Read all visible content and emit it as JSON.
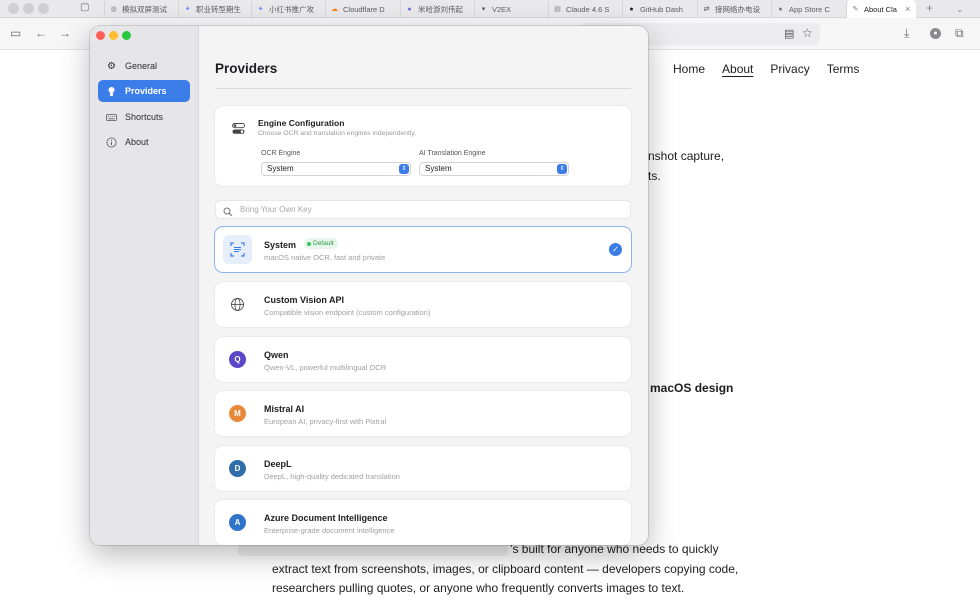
{
  "browser": {
    "tabs": [
      {
        "label": "模拟双屏测试",
        "icon": "globe-icon",
        "color": "#8a8a8f"
      },
      {
        "label": "职业转型期生",
        "icon": "sparkle-icon",
        "color": "#6b8cf5"
      },
      {
        "label": "小红书推广攻",
        "icon": "sparkle-icon",
        "color": "#6b8cf5"
      },
      {
        "label": "Cloudflare D",
        "icon": "cloud-icon",
        "color": "#f38020"
      },
      {
        "label": "米哈游刘伟起",
        "icon": "circle-icon",
        "color": "#6a6ad8"
      },
      {
        "label": "V2EX",
        "icon": "v2ex-icon",
        "color": "#555555"
      },
      {
        "label": "Claude 4.6 S",
        "icon": "doc-icon",
        "color": "#888888"
      },
      {
        "label": "GitHub Dash",
        "icon": "github-icon",
        "color": "#222222"
      },
      {
        "label": "接网络办电设",
        "icon": "link-icon",
        "color": "#555555"
      },
      {
        "label": "App Store C",
        "icon": "apple-icon",
        "color": "#777777"
      },
      {
        "label": "About Cla",
        "icon": "edit-icon",
        "color": "#777777"
      }
    ]
  },
  "site": {
    "nav": [
      "Home",
      "About",
      "Privacy",
      "Terms"
    ],
    "active_nav": "About",
    "fragments": {
      "line1": "nshot capture,",
      "line2": "ts.",
      "line3": "macOS design",
      "para1": "’s built for anyone who needs to quickly",
      "para2": "extract text from screenshots, images, or clipboard content — developers copying code,",
      "para3": "researchers pulling quotes, or anyone who frequently converts images to text."
    }
  },
  "sidebar": {
    "items": [
      {
        "label": "General",
        "icon": "gear-icon",
        "active": false
      },
      {
        "label": "Providers",
        "icon": "lightbulb-icon",
        "active": true
      },
      {
        "label": "Shortcuts",
        "icon": "keyboard-icon",
        "active": false
      },
      {
        "label": "About",
        "icon": "info-icon",
        "active": false
      }
    ]
  },
  "main": {
    "title": "Providers",
    "engine": {
      "title": "Engine Configuration",
      "subtitle": "Choose OCR and translation engines independently.",
      "ocr_label": "OCR Engine",
      "ocr_value": "System",
      "translation_label": "AI Translation Engine",
      "translation_value": "System"
    },
    "search": {
      "placeholder": "Bring Your Own Key",
      "value": ""
    },
    "providers": [
      {
        "name": "System",
        "description": "macOS native OCR, fast and private",
        "badge": "Default",
        "selected": true,
        "logo": "ocr-scan-icon",
        "initial": "",
        "color": "#3a7de8"
      },
      {
        "name": "Custom Vision API",
        "description": "Compatible vision endpoint (custom configuration)",
        "badge": "",
        "selected": false,
        "logo": "globe-icon",
        "initial": "",
        "color": "#ffffff"
      },
      {
        "name": "Qwen",
        "description": "Qwen-VL, powerful multilingual OCR",
        "badge": "",
        "selected": false,
        "logo": "qwen-logo-icon",
        "initial": "Q",
        "color": "#5b48c9"
      },
      {
        "name": "Mistral AI",
        "description": "European AI, privacy-first with Pixtral",
        "badge": "",
        "selected": false,
        "logo": "mistral-logo-icon",
        "initial": "M",
        "color": "#e8893a"
      },
      {
        "name": "DeepL",
        "description": "DeepL, high-quality dedicated translation",
        "badge": "",
        "selected": false,
        "logo": "deepl-logo-icon",
        "initial": "D",
        "color": "#2f6ea8"
      },
      {
        "name": "Azure Document Intelligence",
        "description": "Enterprise-grade document intelligence",
        "badge": "",
        "selected": false,
        "logo": "azure-logo-icon",
        "initial": "A",
        "color": "#2f74c8"
      }
    ]
  },
  "colors": {
    "accent": "#3a7de8",
    "badge_green": "#2d9a46"
  }
}
